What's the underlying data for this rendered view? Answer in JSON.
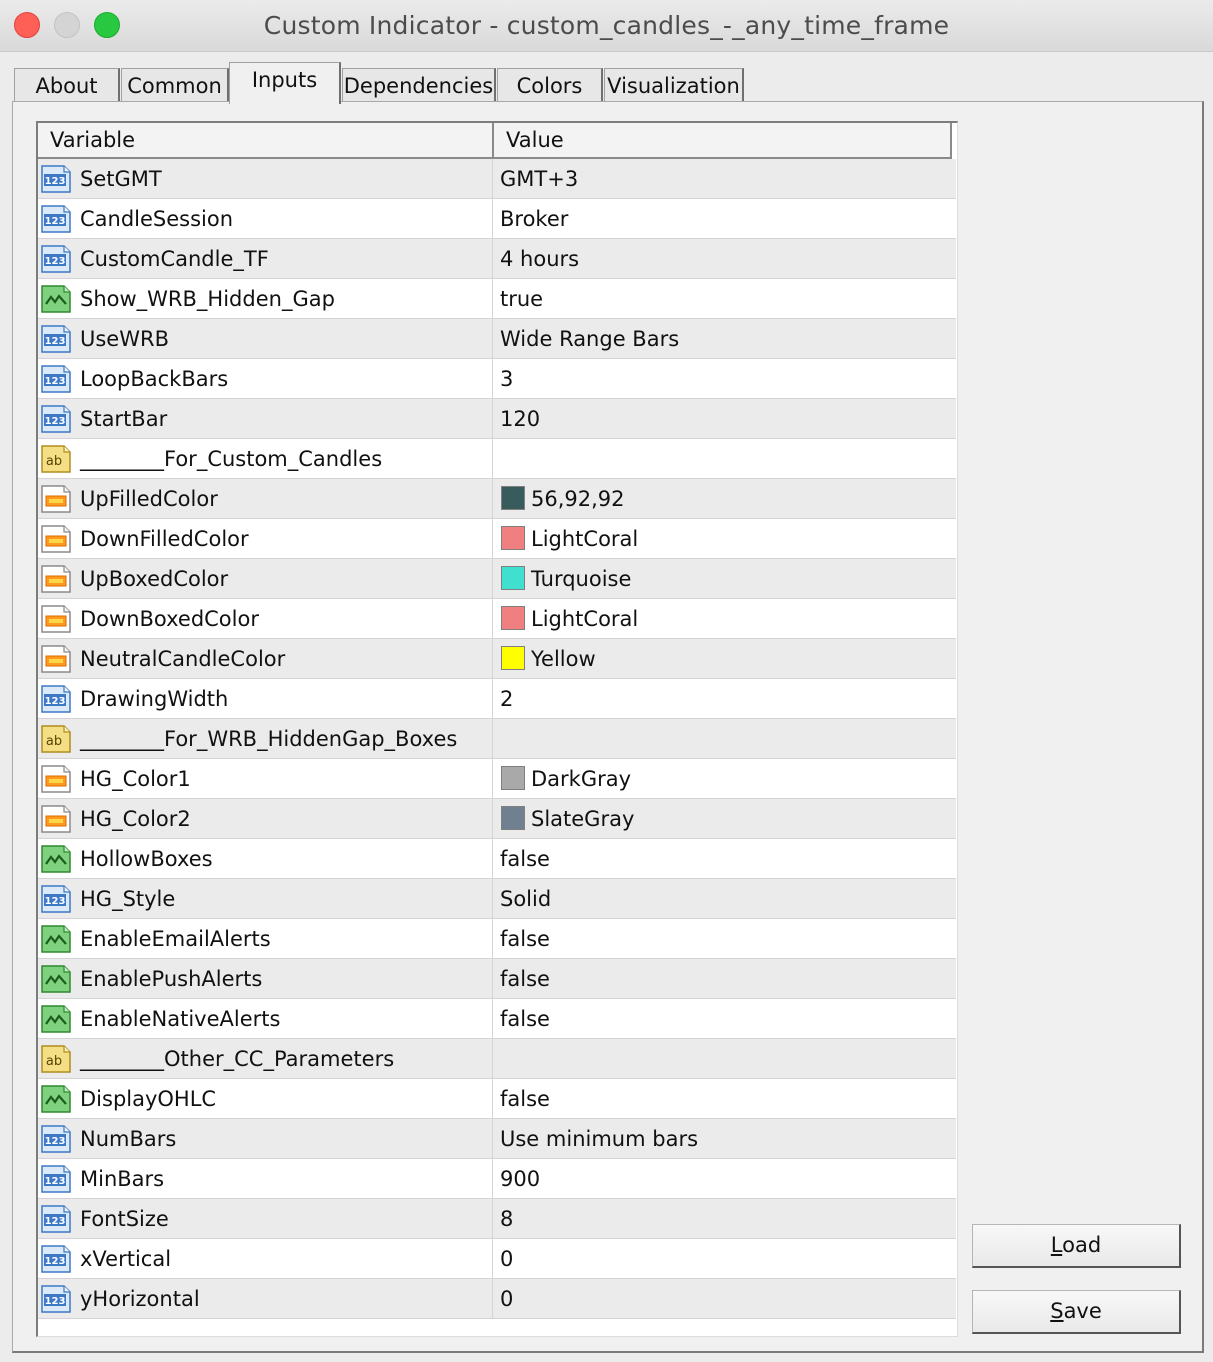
{
  "window": {
    "title": "Custom Indicator - custom_candles_-_any_time_frame"
  },
  "tabs": [
    {
      "label": "About"
    },
    {
      "label": "Common"
    },
    {
      "label": "Inputs",
      "active": true
    },
    {
      "label": "Dependencies"
    },
    {
      "label": "Colors"
    },
    {
      "label": "Visualization"
    }
  ],
  "grid": {
    "columns": {
      "variable": "Variable",
      "value": "Value"
    },
    "rows": [
      {
        "type": "number",
        "variable": "SetGMT",
        "value": "GMT+3"
      },
      {
        "type": "number",
        "variable": "CandleSession",
        "value": "Broker"
      },
      {
        "type": "number",
        "variable": "CustomCandle_TF",
        "value": "4 hours"
      },
      {
        "type": "bool",
        "variable": "Show_WRB_Hidden_Gap",
        "value": "true"
      },
      {
        "type": "number",
        "variable": "UseWRB",
        "value": "Wide Range Bars"
      },
      {
        "type": "number",
        "variable": "LoopBackBars",
        "value": "3"
      },
      {
        "type": "number",
        "variable": "StartBar",
        "value": "120"
      },
      {
        "type": "string",
        "variable": "________For_Custom_Candles",
        "value": ""
      },
      {
        "type": "color",
        "variable": "UpFilledColor",
        "value": "56,92,92",
        "swatch": "#385c5c"
      },
      {
        "type": "color",
        "variable": "DownFilledColor",
        "value": "LightCoral",
        "swatch": "#f08080"
      },
      {
        "type": "color",
        "variable": "UpBoxedColor",
        "value": "Turquoise",
        "swatch": "#40e0d0"
      },
      {
        "type": "color",
        "variable": "DownBoxedColor",
        "value": "LightCoral",
        "swatch": "#f08080"
      },
      {
        "type": "color",
        "variable": "NeutralCandleColor",
        "value": "Yellow",
        "swatch": "#ffff00"
      },
      {
        "type": "number",
        "variable": "DrawingWidth",
        "value": "2"
      },
      {
        "type": "string",
        "variable": "________For_WRB_HiddenGap_Boxes",
        "value": ""
      },
      {
        "type": "color",
        "variable": "HG_Color1",
        "value": "DarkGray",
        "swatch": "#a9a9a9"
      },
      {
        "type": "color",
        "variable": "HG_Color2",
        "value": "SlateGray",
        "swatch": "#708090"
      },
      {
        "type": "bool",
        "variable": "HollowBoxes",
        "value": "false"
      },
      {
        "type": "number",
        "variable": "HG_Style",
        "value": "Solid"
      },
      {
        "type": "bool",
        "variable": "EnableEmailAlerts",
        "value": "false"
      },
      {
        "type": "bool",
        "variable": "EnablePushAlerts",
        "value": "false"
      },
      {
        "type": "bool",
        "variable": "EnableNativeAlerts",
        "value": "false"
      },
      {
        "type": "string",
        "variable": "________Other_CC_Parameters",
        "value": ""
      },
      {
        "type": "bool",
        "variable": "DisplayOHLC",
        "value": "false"
      },
      {
        "type": "number",
        "variable": "NumBars",
        "value": "Use minimum bars"
      },
      {
        "type": "number",
        "variable": "MinBars",
        "value": "900"
      },
      {
        "type": "number",
        "variable": "FontSize",
        "value": "8"
      },
      {
        "type": "number",
        "variable": "xVertical",
        "value": "0"
      },
      {
        "type": "number",
        "variable": "yHorizontal",
        "value": "0"
      }
    ]
  },
  "buttons": {
    "load": {
      "mnemonic": "L",
      "rest": "oad"
    },
    "save": {
      "mnemonic": "S",
      "rest": "ave"
    }
  },
  "colors": {
    "close": "#fe5f57",
    "minimize": "#d4d4d4",
    "zoom": "#28c840"
  },
  "icons": {
    "number": "numeric-123-icon",
    "bool": "boolean-toggle-icon",
    "string": "string-ab-icon",
    "color": "color-picker-icon"
  }
}
